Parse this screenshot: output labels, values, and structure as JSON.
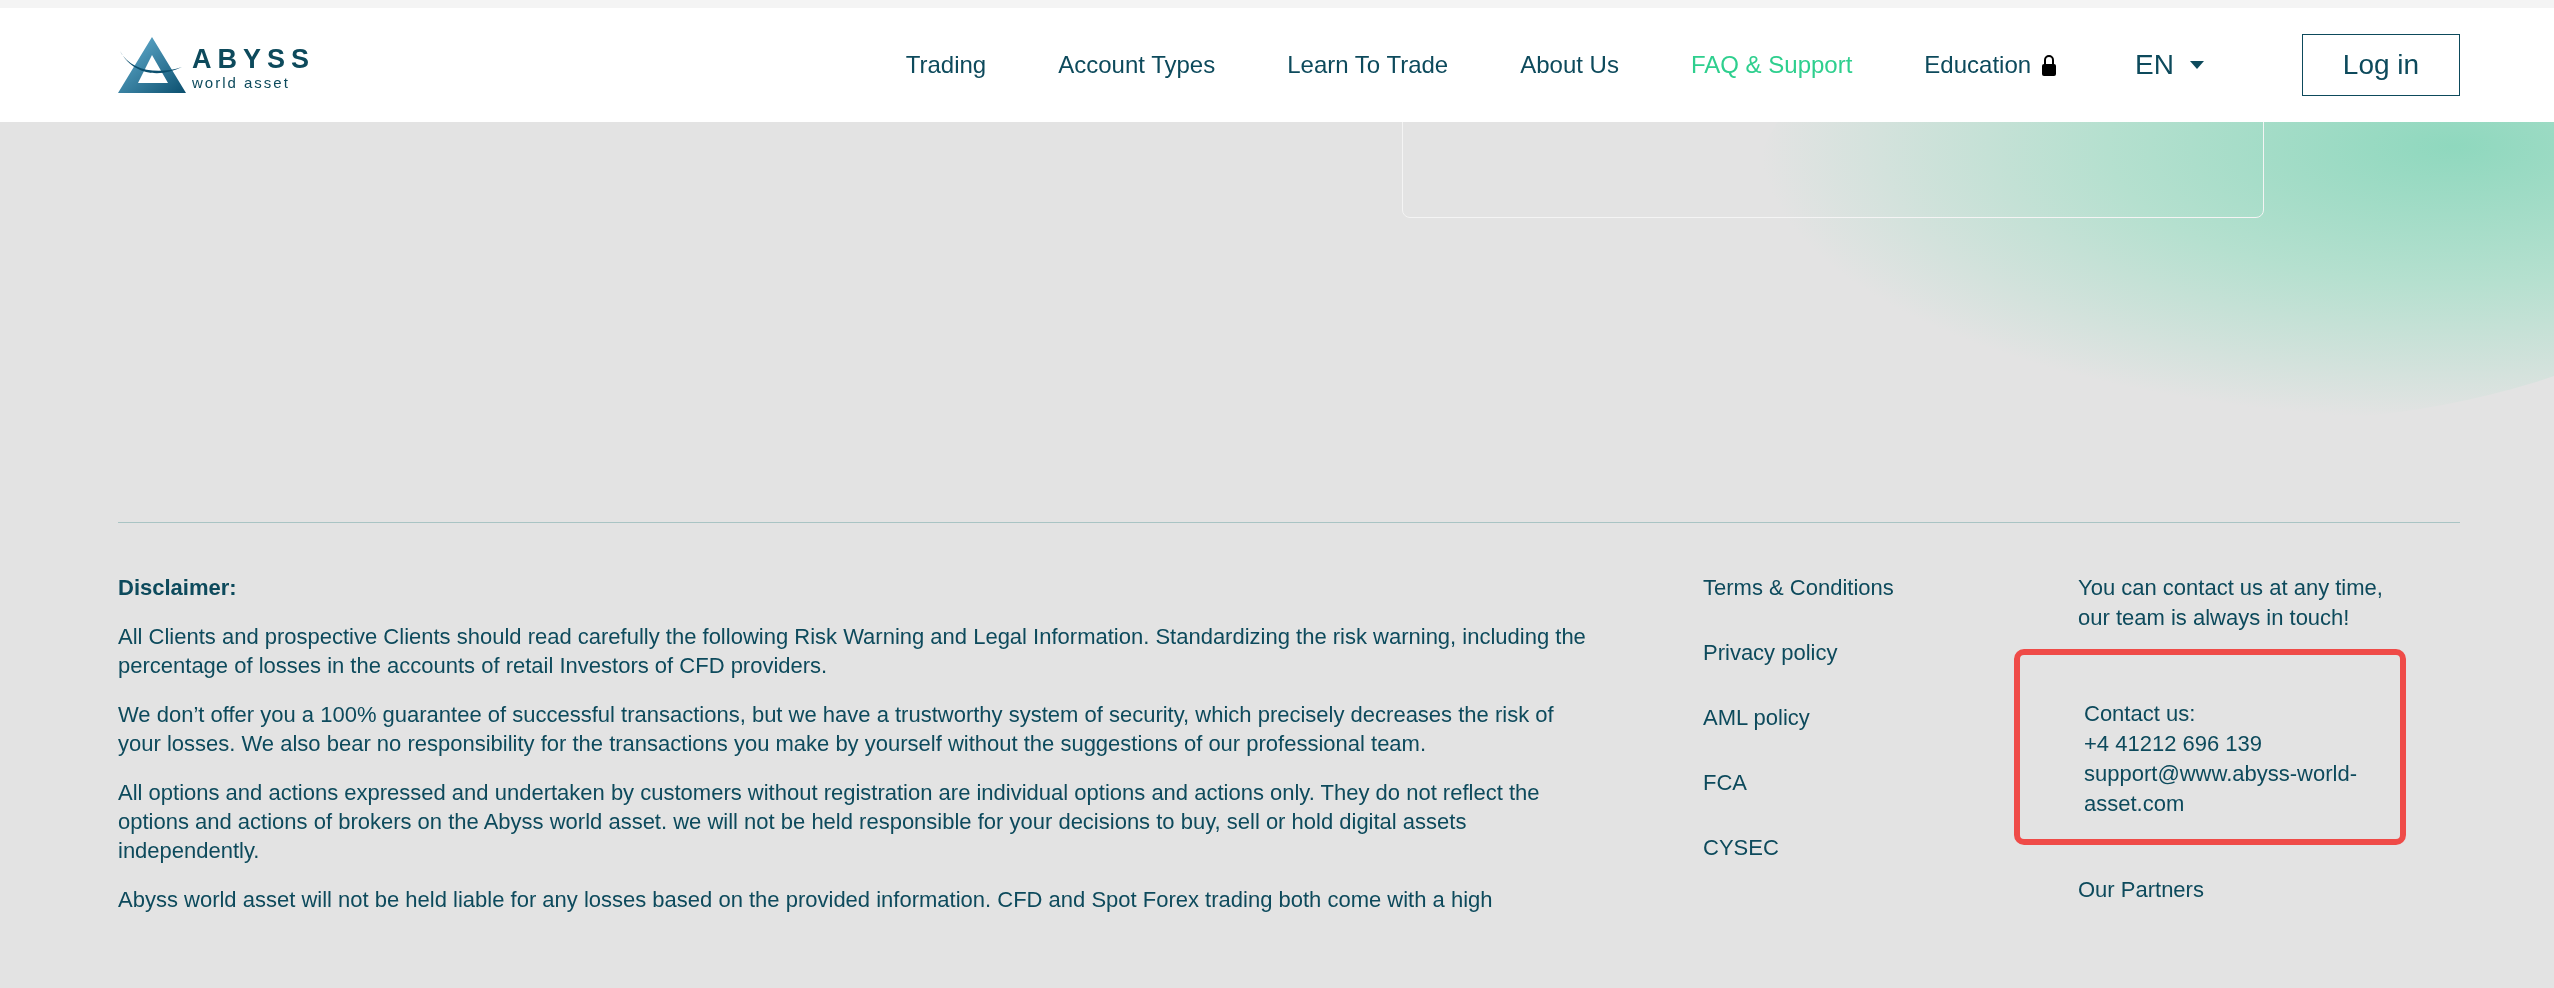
{
  "header": {
    "logo": {
      "name": "ABYSS",
      "tagline": "world asset"
    },
    "nav": [
      {
        "label": "Trading",
        "selected": false,
        "locked": false
      },
      {
        "label": "Account Types",
        "selected": false,
        "locked": false
      },
      {
        "label": "Learn To Trade",
        "selected": false,
        "locked": false
      },
      {
        "label": "About Us",
        "selected": false,
        "locked": false
      },
      {
        "label": "FAQ & Support",
        "selected": true,
        "locked": false
      },
      {
        "label": "Education",
        "selected": false,
        "locked": true
      }
    ],
    "language": "EN",
    "login": "Log in"
  },
  "footer": {
    "disclaimer": {
      "title": "Disclaimer:",
      "paragraphs": [
        "All Clients and prospective Clients should read carefully the following Risk Warning and Legal Information. Standardizing the risk warning, including the percentage of losses in the accounts of retail Investors of CFD providers.",
        "We don’t offer you a 100% guarantee of successful transactions, but we have a trustworthy system of security, which precisely decreases the risk of your losses. We also bear no responsibility for the transactions you make by yourself without the suggestions of our professional team.",
        "All options and actions expressed and undertaken by customers without registration are individual options and actions only. They do not reflect the options and actions of brokers on the Abyss world asset. we will not be held responsible for your decisions to buy, sell or hold digital assets independently.",
        "Abyss world asset will not be held liable for any losses based on the provided information. CFD and Spot Forex trading both come with a high"
      ]
    },
    "links": [
      "Terms & Conditions",
      "Privacy policy",
      "AML policy",
      "FCA",
      "CYSEC"
    ],
    "contact": {
      "intro": "You can contact us at any time, our team is always in touch!",
      "highlighted": true,
      "label": "Contact us:",
      "phone": "+4 41212 696 139",
      "email": "support@www.abyss-world-asset.com",
      "partners": "Our Partners"
    }
  }
}
